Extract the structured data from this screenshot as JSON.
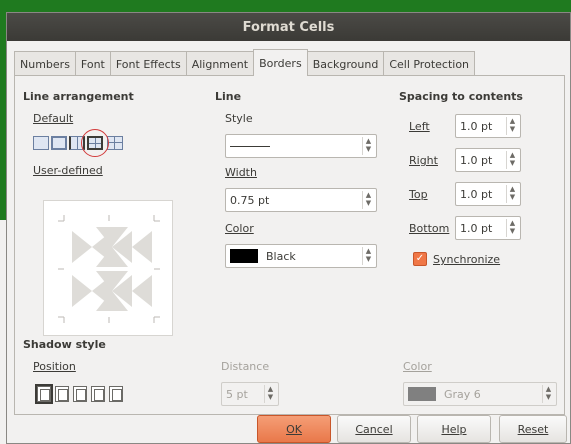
{
  "window": {
    "title": "Format Cells"
  },
  "tabs": [
    "Numbers",
    "Font",
    "Font Effects",
    "Alignment",
    "Borders",
    "Background",
    "Cell Protection"
  ],
  "active_tab": "Borders",
  "line_arrangement": {
    "heading": "Line arrangement",
    "default_label": "Default",
    "user_defined_label": "User-defined"
  },
  "line": {
    "heading": "Line",
    "style_label": "Style",
    "width_label": "Width",
    "width_value": "0.75 pt",
    "color_label": "Color",
    "color_value": "Black",
    "color_hex": "#000000"
  },
  "spacing": {
    "heading": "Spacing to contents",
    "left_label": "Left",
    "left_value": "1.0 pt",
    "right_label": "Right",
    "right_value": "1.0 pt",
    "top_label": "Top",
    "top_value": "1.0 pt",
    "bottom_label": "Bottom",
    "bottom_value": "1.0 pt",
    "synchronize_label": "Synchronize",
    "synchronize_checked": true
  },
  "shadow": {
    "heading": "Shadow style",
    "position_label": "Position",
    "distance_label": "Distance",
    "distance_value": "5 pt",
    "color_label": "Color",
    "color_value": "Gray 6",
    "color_hex": "#808080"
  },
  "buttons": {
    "ok": "OK",
    "cancel": "Cancel",
    "help": "Help",
    "reset": "Reset"
  }
}
